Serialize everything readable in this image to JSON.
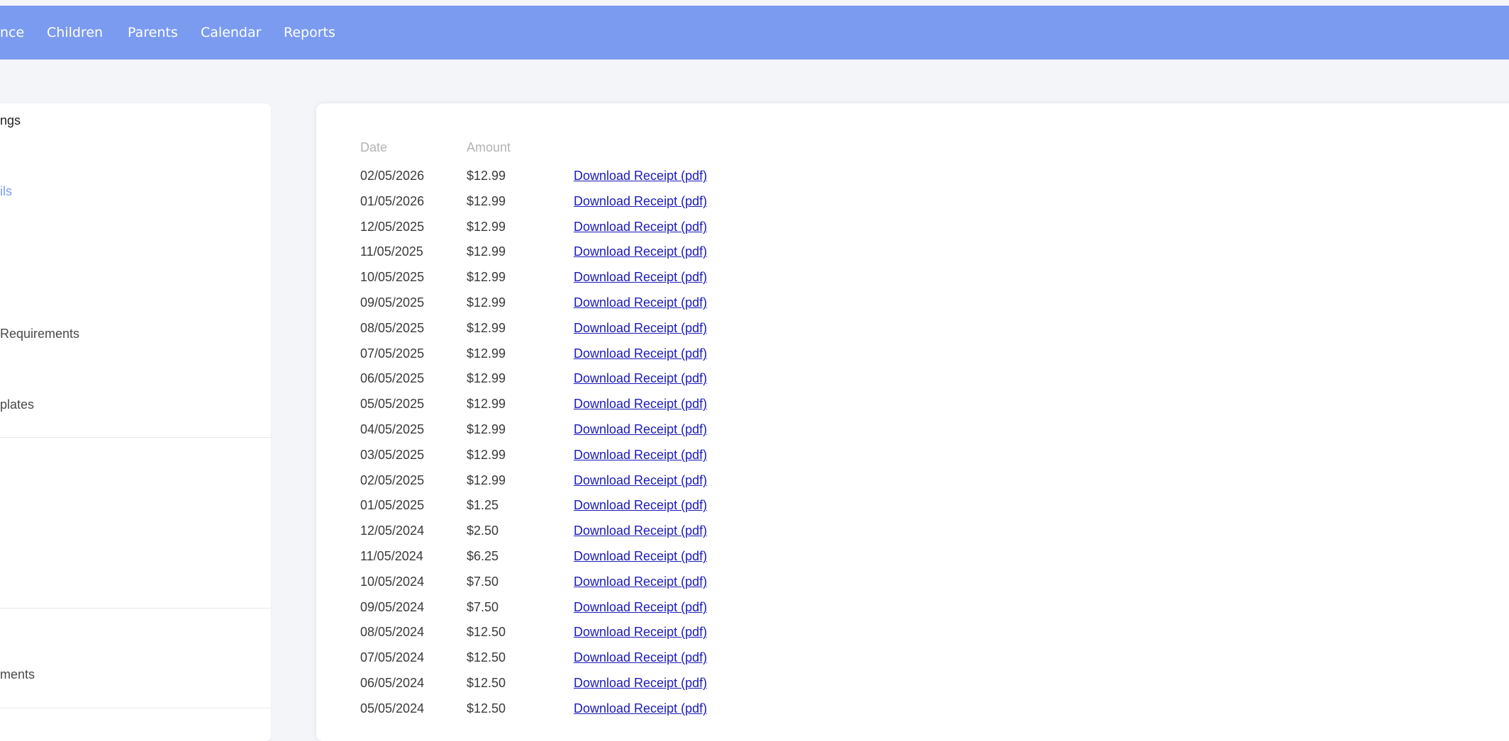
{
  "nav": {
    "items": [
      "nce",
      "Children",
      "Parents",
      "Calendar",
      "Reports"
    ]
  },
  "sidebar": {
    "items": [
      "ngs",
      "ils",
      "Requirements",
      "plates",
      "ments"
    ]
  },
  "table": {
    "headers": {
      "date": "Date",
      "amount": "Amount"
    },
    "rows": [
      {
        "date": "02/05/2026",
        "amount": "$12.99",
        "link": "Download Receipt (pdf)"
      },
      {
        "date": "01/05/2026",
        "amount": "$12.99",
        "link": "Download Receipt (pdf)"
      },
      {
        "date": "12/05/2025",
        "amount": "$12.99",
        "link": "Download Receipt (pdf)"
      },
      {
        "date": "11/05/2025",
        "amount": "$12.99",
        "link": "Download Receipt (pdf)"
      },
      {
        "date": "10/05/2025",
        "amount": "$12.99",
        "link": "Download Receipt (pdf)"
      },
      {
        "date": "09/05/2025",
        "amount": "$12.99",
        "link": "Download Receipt (pdf)"
      },
      {
        "date": "08/05/2025",
        "amount": "$12.99",
        "link": "Download Receipt (pdf)"
      },
      {
        "date": "07/05/2025",
        "amount": "$12.99",
        "link": "Download Receipt (pdf)"
      },
      {
        "date": "06/05/2025",
        "amount": "$12.99",
        "link": "Download Receipt (pdf)"
      },
      {
        "date": "05/05/2025",
        "amount": "$12.99",
        "link": "Download Receipt (pdf)"
      },
      {
        "date": "04/05/2025",
        "amount": "$12.99",
        "link": "Download Receipt (pdf)"
      },
      {
        "date": "03/05/2025",
        "amount": "$12.99",
        "link": "Download Receipt (pdf)"
      },
      {
        "date": "02/05/2025",
        "amount": "$12.99",
        "link": "Download Receipt (pdf)"
      },
      {
        "date": "01/05/2025",
        "amount": "$1.25",
        "link": "Download Receipt (pdf)"
      },
      {
        "date": "12/05/2024",
        "amount": "$2.50",
        "link": "Download Receipt (pdf)"
      },
      {
        "date": "11/05/2024",
        "amount": "$6.25",
        "link": "Download Receipt (pdf)"
      },
      {
        "date": "10/05/2024",
        "amount": "$7.50",
        "link": "Download Receipt (pdf)"
      },
      {
        "date": "09/05/2024",
        "amount": "$7.50",
        "link": "Download Receipt (pdf)"
      },
      {
        "date": "08/05/2024",
        "amount": "$12.50",
        "link": "Download Receipt (pdf)"
      },
      {
        "date": "07/05/2024",
        "amount": "$12.50",
        "link": "Download Receipt (pdf)"
      },
      {
        "date": "06/05/2024",
        "amount": "$12.50",
        "link": "Download Receipt (pdf)"
      },
      {
        "date": "05/05/2024",
        "amount": "$12.50",
        "link": "Download Receipt (pdf)"
      }
    ]
  },
  "colors": {
    "nav_bg": "#7b9bf0",
    "link": "#1a1ab8",
    "active_sidebar": "#7b9bf0",
    "page_bg": "#f4f5f9"
  }
}
